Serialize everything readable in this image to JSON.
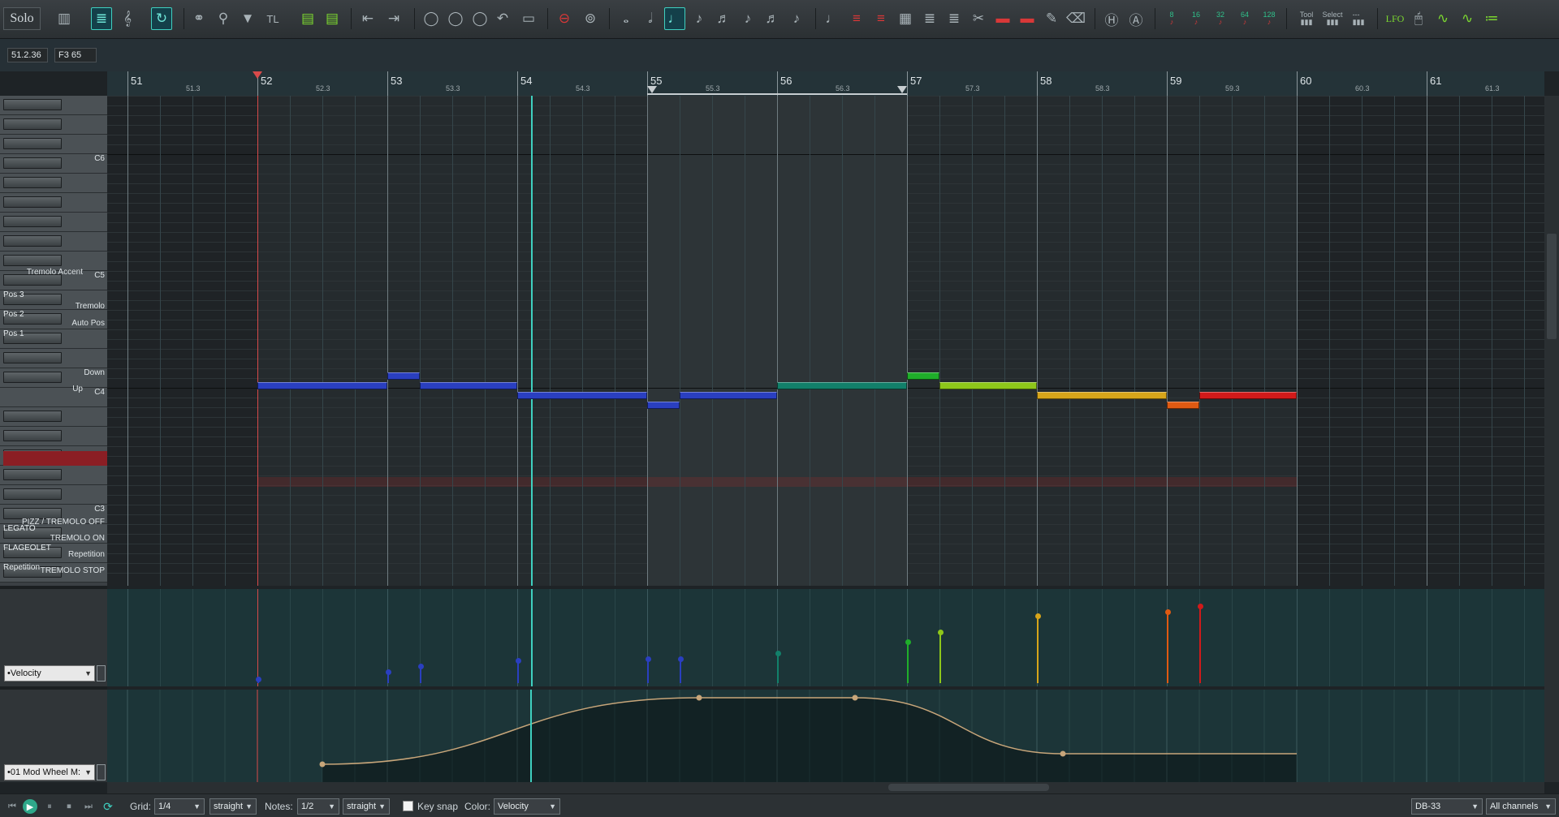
{
  "toolbar": {
    "solo_label": "Solo",
    "text_label_tl": "TL",
    "lfo_label": "LFO",
    "velocity_values": [
      "8",
      "16",
      "32",
      "64",
      "128"
    ],
    "tool_label": "Tool",
    "select_label": "Select"
  },
  "info": {
    "position": "51.2.36",
    "note": "F3  65"
  },
  "ruler": {
    "bars": [
      "51",
      "52",
      "53",
      "54",
      "55",
      "56",
      "57",
      "58",
      "59",
      "60",
      "61"
    ],
    "beats": [
      "51.3",
      "52.3",
      "53.3",
      "54.3",
      "55.3",
      "56.3",
      "57.3",
      "58.3",
      "59.3",
      "60.3",
      "61.3"
    ]
  },
  "piano": {
    "octave_labels": [
      "C6",
      "C5",
      "C4",
      "C3"
    ],
    "key_labels": [
      "Tremolo Accent",
      "Tremolo",
      "Auto Pos",
      "Down",
      "Up",
      "PIZZ / TREMOLO OFF",
      "TREMOLO ON",
      "Repetition",
      "TREMOLO STOP"
    ],
    "left_labels": [
      "Pos 3",
      "Pos 2",
      "Pos 1",
      "LEGATO",
      "FLAGEOLET",
      "Repetition"
    ]
  },
  "lanes": {
    "velocity_lane": "•Velocity",
    "cc_lane": "•01 Mod Wheel M:"
  },
  "notes": [
    {
      "start": 52.0,
      "len": 1.0,
      "row": 9,
      "color": "#2a3fc0",
      "vel": 6
    },
    {
      "start": 53.0,
      "len": 0.25,
      "row": 8,
      "color": "#2a3fc0",
      "vel": 16
    },
    {
      "start": 53.25,
      "len": 0.75,
      "row": 9,
      "color": "#2a3fc0",
      "vel": 24
    },
    {
      "start": 54.0,
      "len": 1.0,
      "row": 10,
      "color": "#2a3fc0",
      "vel": 32
    },
    {
      "start": 55.0,
      "len": 0.25,
      "row": 11,
      "color": "#2a3fc0",
      "vel": 34
    },
    {
      "start": 55.25,
      "len": 0.75,
      "row": 10,
      "color": "#2a3fc0",
      "vel": 34
    },
    {
      "start": 56.0,
      "len": 1.0,
      "row": 9,
      "color": "#12806a",
      "vel": 42
    },
    {
      "start": 57.0,
      "len": 0.25,
      "row": 8,
      "color": "#1fae2a",
      "vel": 58
    },
    {
      "start": 57.25,
      "len": 0.75,
      "row": 9,
      "color": "#8ec71a",
      "vel": 72
    },
    {
      "start": 58.0,
      "len": 1.0,
      "row": 10,
      "color": "#d7a51a",
      "vel": 94
    },
    {
      "start": 59.0,
      "len": 0.25,
      "row": 11,
      "color": "#e05a12",
      "vel": 100
    },
    {
      "start": 59.25,
      "len": 0.75,
      "row": 10,
      "color": "#d21a1a",
      "vel": 108
    }
  ],
  "cc_points": [
    {
      "pos": 52.5,
      "val": 18
    },
    {
      "pos": 55.4,
      "val": 100
    },
    {
      "pos": 56.6,
      "val": 100
    },
    {
      "pos": 58.2,
      "val": 31
    },
    {
      "pos": 60.0,
      "val": 31
    }
  ],
  "bottom": {
    "grid_label": "Grid:",
    "grid_value": "1/4",
    "grid_type": "straight",
    "notes_label": "Notes:",
    "notes_value": "1/2",
    "notes_type": "straight",
    "keysnap_label": "Key snap",
    "color_label": "Color:",
    "color_value": "Velocity",
    "device": "DB-33",
    "channels": "All channels"
  },
  "colors": {
    "accent": "#3fd0c0",
    "playhead": "#3fd0c0",
    "edit_cursor": "#d84a4a",
    "cc_line": "#c8a67a"
  }
}
